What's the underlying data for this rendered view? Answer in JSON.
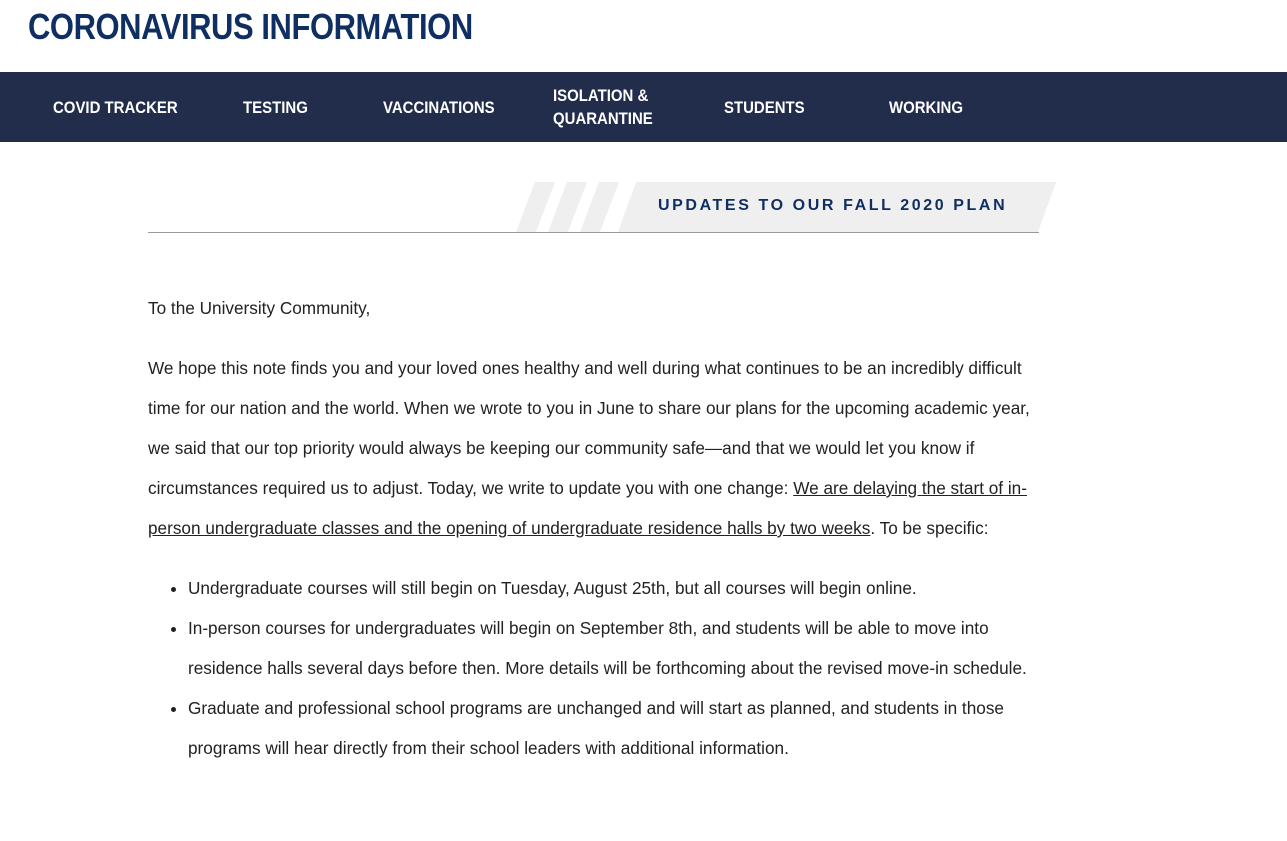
{
  "site": {
    "title": "CORONAVIRUS INFORMATION"
  },
  "nav": {
    "items": [
      {
        "label": "COVID TRACKER"
      },
      {
        "label": "TESTING"
      },
      {
        "label": "VACCINATIONS"
      },
      {
        "label": "ISOLATION &\nQUARANTINE"
      },
      {
        "label": "STUDENTS"
      },
      {
        "label": "WORKING"
      }
    ]
  },
  "banner": {
    "title": "UPDATES TO OUR FALL 2020 PLAN"
  },
  "letter": {
    "salutation": "To the University Community,",
    "intro": "We hope this note finds you and your loved ones healthy and well during what continues to be an incredibly difficult time for our nation and the world. When we wrote to you in June to share our plans for the upcoming academic year, we said that our top priority would always be keeping our community safe—and that we would let you know if circumstances required us to adjust. Today, we write to update you with one change: ",
    "highlight_link": "We are delaying the start of in-person undergraduate classes and the opening of undergraduate residence halls by two weeks",
    "intro_end": ". To be specific:",
    "bullets": [
      "Undergraduate courses will still begin on Tuesday, August 25th, but all courses will begin online.",
      "In-person courses for undergraduates will begin on September 8th, and students will be able to move into residence halls several days before then. More details will be forthcoming about the revised move-in schedule.",
      "Graduate and professional school programs are unchanged and will start as planned, and students in those programs will hear directly from their school leaders with additional information."
    ]
  },
  "colors": {
    "navy": "#0f2f62",
    "nav_bg": "#222c4b",
    "banner_bg": "#efefef",
    "text": "#222222"
  }
}
